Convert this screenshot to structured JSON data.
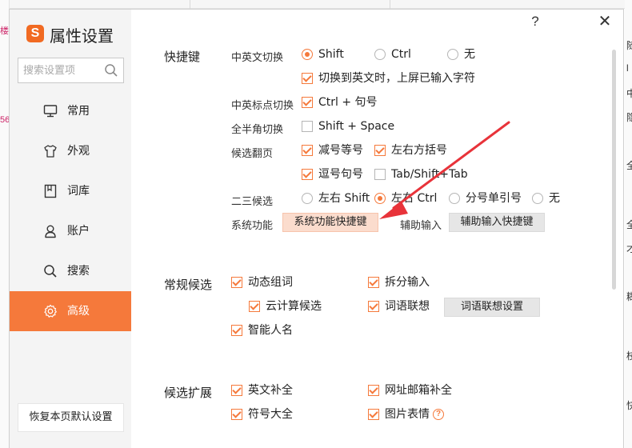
{
  "app": {
    "title": "属性设置",
    "logo_glyph": "S"
  },
  "window": {
    "help": "?",
    "close": "✕"
  },
  "search": {
    "placeholder": "搜索设置项"
  },
  "sidebar": {
    "items": [
      {
        "label": "常用",
        "icon": "monitor-icon"
      },
      {
        "label": "外观",
        "icon": "tshirt-icon"
      },
      {
        "label": "词库",
        "icon": "book-icon"
      },
      {
        "label": "账户",
        "icon": "user-icon"
      },
      {
        "label": "搜索",
        "icon": "search-icon"
      },
      {
        "label": "高级",
        "icon": "gear-icon",
        "active": true
      }
    ],
    "restore_label": "恢复本页默认设置"
  },
  "hotkeys": {
    "title": "快捷键",
    "cn_en_switch": {
      "label": "中英文切换",
      "options": [
        {
          "label": "Shift",
          "selected": true
        },
        {
          "label": "Ctrl",
          "selected": false
        },
        {
          "label": "无",
          "selected": false
        }
      ],
      "commit_on_switch": {
        "label": "切换到英文时，上屏已输入字符",
        "checked": true
      }
    },
    "punct_switch": {
      "label": "中英标点切换",
      "option": {
        "label": "Ctrl + 句号",
        "checked": true
      }
    },
    "full_half": {
      "label": "全半角切换",
      "option": {
        "label": "Shift + Space",
        "checked": false
      }
    },
    "paging": {
      "label": "候选翻页",
      "options": [
        {
          "label": "减号等号",
          "checked": true
        },
        {
          "label": "左右方括号",
          "checked": true
        },
        {
          "label": "逗号句号",
          "checked": true
        },
        {
          "label": "Tab/Shift+Tab",
          "checked": false
        }
      ]
    },
    "second_third": {
      "label": "二三候选",
      "options": [
        {
          "label": "左右 Shift",
          "selected": false
        },
        {
          "label": "左右 Ctrl",
          "selected": true
        },
        {
          "label": "分号单引号",
          "selected": false
        },
        {
          "label": "无",
          "selected": false
        }
      ]
    },
    "system": {
      "label": "系统功能",
      "button": "系统功能快捷键"
    },
    "assist": {
      "label": "辅助输入",
      "button": "辅助输入快捷键"
    }
  },
  "candidates": {
    "title": "常规候选",
    "options": [
      {
        "label": "动态组词",
        "checked": true
      },
      {
        "label": "拆分输入",
        "checked": true
      },
      {
        "label": "云计算候选",
        "checked": true
      },
      {
        "label": "词语联想",
        "checked": true
      },
      {
        "label": "智能人名",
        "checked": true
      }
    ],
    "assoc_button": "词语联想设置"
  },
  "extension": {
    "title": "候选扩展",
    "options": [
      {
        "label": "英文补全",
        "checked": true
      },
      {
        "label": "网址邮箱补全",
        "checked": true
      },
      {
        "label": "符号大全",
        "checked": true
      },
      {
        "label": "图片表情",
        "checked": true
      }
    ]
  },
  "background": {
    "left_chars": [
      "楼",
      "56"
    ],
    "right_chars": [
      "随",
      "l",
      "中",
      "隐",
      "全",
      "全",
      "才",
      "糊",
      "枝",
      "快"
    ]
  },
  "colors": {
    "accent": "#f5793b",
    "highlight_button": "#fbdccd",
    "arrow": "#e8333a"
  }
}
